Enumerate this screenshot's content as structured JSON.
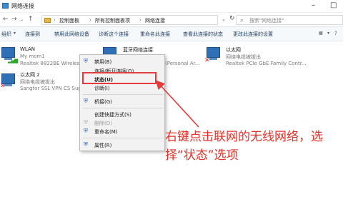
{
  "window": {
    "title": "网络连接"
  },
  "address": {
    "crumbs": [
      "控制面板",
      "所有控制面板项",
      "网络连接"
    ],
    "search_placeholder": "搜索\"网络连接\""
  },
  "toolbar": {
    "items": [
      "组织",
      "连接到",
      "禁用此网络设备",
      "诊断这个连接",
      "重命名此连接",
      "查看此连接的状态",
      "更改此连接的设置"
    ]
  },
  "connections": [
    {
      "name": "WLAN",
      "line2": "My mom1",
      "line3": "Realtek 8822BE Wireless",
      "status_icon": "signal-bars"
    },
    {
      "name": "蓝牙网络连接",
      "line2": "",
      "line3": "(Personal Ar...",
      "status_icon": "red-x"
    },
    {
      "name": "以太网",
      "line2": "网络电缆被拔出",
      "line3": "Realtek PCIe GbE Family Contr...",
      "status_icon": "red-x"
    },
    {
      "name": "以太网 2",
      "line2": "网络电缆被拔出",
      "line3": "Sangfor SSL VPN CS Supp",
      "status_icon": "red-x"
    }
  ],
  "context_menu": {
    "items": [
      {
        "label": "禁用(B)",
        "icon": "shield-icon",
        "enabled": true
      },
      {
        "label": "连接/断开连接(O)",
        "icon": "",
        "enabled": true
      },
      {
        "label": "状态(U)",
        "icon": "",
        "enabled": true,
        "bold": true
      },
      {
        "label": "诊断(I)",
        "icon": "",
        "enabled": true
      },
      {
        "label": "桥接(G)",
        "icon": "shield-icon",
        "enabled": true
      },
      {
        "label": "创建快捷方式(S)",
        "icon": "",
        "enabled": true
      },
      {
        "label": "删除(D)",
        "icon": "shield-icon",
        "enabled": false
      },
      {
        "label": "重命名(M)",
        "icon": "shield-icon",
        "enabled": true
      },
      {
        "label": "属性(R)",
        "icon": "shield-icon",
        "enabled": true
      }
    ]
  },
  "annotation": {
    "line1": "右键点击联网的无线网络，选",
    "line2": "择“状态”选项"
  },
  "colors": {
    "highlight": "#e43b3b",
    "annotation": "#e4312a",
    "link": "#1d3c63"
  }
}
